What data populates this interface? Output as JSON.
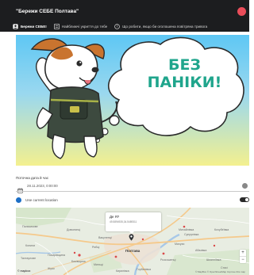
{
  "app": {
    "title": "\"Бережи СЕБЕ Полтава\""
  },
  "tabs": [
    {
      "label": "Бережи СЕБЕ!",
      "icon": "account-box-icon",
      "active": true
    },
    {
      "label": "Найближчі укриття до тебе",
      "icon": "list-icon",
      "active": false
    },
    {
      "label": "Що робити, якщо би оголошена повітряна тривога",
      "icon": "help-circle-icon",
      "active": false
    }
  ],
  "banner": {
    "bubble_line1": "БЕЗ",
    "bubble_line2": "ПАНІКИ!"
  },
  "datetime": {
    "label": "Поточна дата й час",
    "value": "28.11.2023, 0:00:00"
  },
  "location": {
    "label": "Use current location",
    "enabled": true
  },
  "map": {
    "popup_title": "Де Я?",
    "popup_coords": "49.5894935,34.5489311",
    "city": "Полтава",
    "places": [
      "Пальчикове",
      "Доволинці",
      "Михайлівка",
      "Супрунівка",
      "Кочубеївка",
      "Вакуленці",
      "Копили",
      "Мачухи",
      "Рибці",
      "Абазівка",
      "Писарівщина",
      "Тахтаулове",
      "Розсошенці",
      "Шмигліївка",
      "Биківщина",
      "Мильці",
      "Стасі",
      "Горбанівка",
      "Жуки",
      "Кирилівка"
    ],
    "zoom_in": "+",
    "zoom_out": "−",
    "attribution": "© MapBox © OpenStreetMap Improve this map",
    "logo": "© mapbox"
  },
  "colors": {
    "appbar": "#1c1d1f",
    "close": "#ea4d5a",
    "bubble_text": "#1fa58c",
    "accent_blue": "#1d6fc6"
  }
}
